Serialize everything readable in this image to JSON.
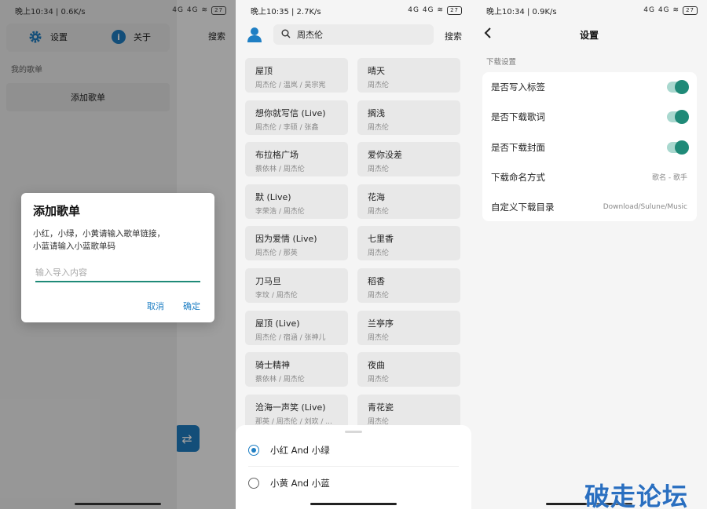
{
  "panel1": {
    "status_time": "晚上10:34 | 0.6K/s",
    "status_icons": "4G 4G",
    "battery": "27",
    "drawer": {
      "settings_label": "设置",
      "about_label": "关于",
      "section_label": "我的歌单",
      "add_playlist": "添加歌单"
    },
    "behind_search": "搜索",
    "dialog": {
      "title": "添加歌单",
      "message_line1": "小红，小绿，小黄请输入歌单链接，",
      "message_line2": "小蓝请输入小蓝歌单码",
      "input_placeholder": "输入导入内容",
      "cancel": "取消",
      "confirm": "确定"
    }
  },
  "panel2": {
    "status_time": "晚上10:35 | 2.7K/s",
    "status_icons": "4G 4G",
    "battery": "27",
    "search_value": "周杰伦",
    "search_button": "搜索",
    "songs": [
      {
        "title": "屋顶",
        "artist": "周杰伦 / 温岚 / 吴宗宪"
      },
      {
        "title": "晴天",
        "artist": "周杰伦"
      },
      {
        "title": "想你就写信 (Live)",
        "artist": "周杰伦 / 李硕 / 张鑫"
      },
      {
        "title": "搁浅",
        "artist": "周杰伦"
      },
      {
        "title": "布拉格广场",
        "artist": "蔡依林 / 周杰伦"
      },
      {
        "title": "爱你没差",
        "artist": "周杰伦"
      },
      {
        "title": "默 (Live)",
        "artist": "李荣浩 / 周杰伦"
      },
      {
        "title": "花海",
        "artist": "周杰伦"
      },
      {
        "title": "因为爱情 (Live)",
        "artist": "周杰伦 / 那英"
      },
      {
        "title": "七里香",
        "artist": "周杰伦"
      },
      {
        "title": "刀马旦",
        "artist": "李玟 / 周杰伦"
      },
      {
        "title": "稻香",
        "artist": "周杰伦"
      },
      {
        "title": "屋顶 (Live)",
        "artist": "周杰伦 / 宿涵 / 张神儿"
      },
      {
        "title": "兰亭序",
        "artist": "周杰伦"
      },
      {
        "title": "骑士精神",
        "artist": "蔡依林 / 周杰伦"
      },
      {
        "title": "夜曲",
        "artist": "周杰伦"
      },
      {
        "title": "沧海一声笑 (Live)",
        "artist": "那英 / 周杰伦 / 刘欢 / ..."
      },
      {
        "title": "青花瓷",
        "artist": "周杰伦"
      }
    ],
    "sheet": {
      "option1": "小红 And 小绿",
      "option2": "小黄 And 小蓝",
      "selected": 1
    }
  },
  "panel3": {
    "status_time": "晚上10:34 | 0.9K/s",
    "status_icons": "4G 4G",
    "battery": "27",
    "title": "设置",
    "group_label": "下载设置",
    "rows": [
      {
        "label": "是否写入标签",
        "type": "toggle",
        "on": true
      },
      {
        "label": "是否下载歌词",
        "type": "toggle",
        "on": true
      },
      {
        "label": "是否下载封面",
        "type": "toggle",
        "on": true
      },
      {
        "label": "下载命名方式",
        "type": "value",
        "value": "歌名 - 歌手"
      },
      {
        "label": "自定义下载目录",
        "type": "value",
        "value": "Download/Sulune/Music"
      }
    ]
  },
  "watermark": "破走论坛",
  "colors": {
    "accent": "#1f7fc4",
    "toggle": "#1f8a78"
  }
}
